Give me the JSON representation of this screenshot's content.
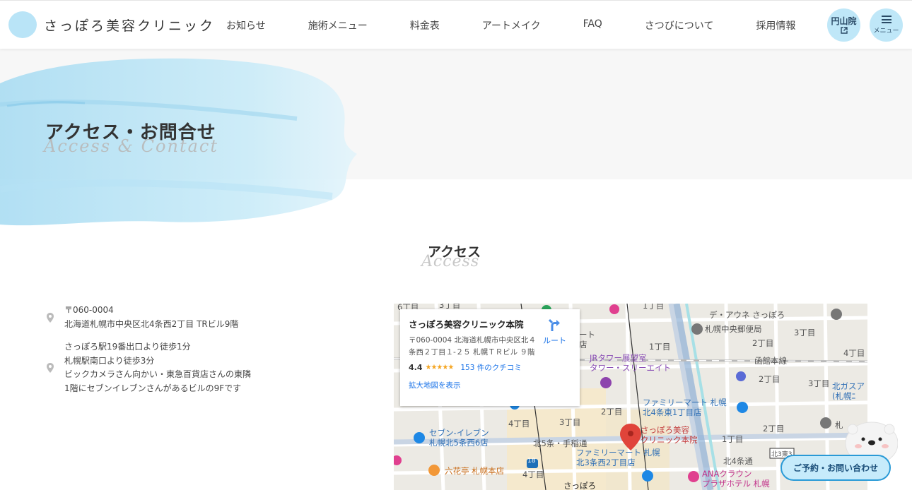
{
  "header": {
    "logo_text": "さっぽろ美容クリニック",
    "nav": [
      "お知らせ",
      "施術メニュー",
      "料金表",
      "アートメイク",
      "FAQ",
      "さつびについて",
      "採用情報"
    ],
    "maruyama_label": "円山院",
    "maruyama_icon": "external-link-icon",
    "menu_label": "メニュー"
  },
  "hero": {
    "title": "アクセス・お問合せ",
    "subtitle": "Access & Contact"
  },
  "access": {
    "title": "アクセス",
    "subtitle": "Access",
    "address": {
      "postal": "〒060-0004",
      "line": "北海道札幌市中央区北4条西2丁目 TRビル9階"
    },
    "directions": [
      "さっぽろ駅19番出口より徒歩1分",
      "札幌駅南口より徒歩3分",
      "ビックカメラさん向かい・東急百貨店さんの東隣",
      "1階にセブンイレブンさんがあるビルの9Fです"
    ]
  },
  "map": {
    "card": {
      "name": "さっぽろ美容クリニック本院",
      "address": "〒060-0004 北海道札幌市中央区北４条西２丁目１-２５ 札幌ＴＲビル ９階",
      "rating": "4.4",
      "stars": "★★★★★",
      "reviews": "153 件のクチコミ",
      "route": "ルート",
      "larger_map": "拡大地図を表示"
    },
    "labels": {
      "clinic": "さっぽろ美容\nクリニック本院",
      "de_aune": "デ・アウネ さっぽろ",
      "post_office": "札幌中央郵便局",
      "jr_tower": "JRタワー展望室\nタワー・スリーエイト",
      "family_mart_1": "ファミリーマート 札幌\n北4条東1丁目店",
      "seven": "セブン-イレブン\n札幌北5条西6店",
      "rokkatei": "六花亭 札幌本店",
      "kita5": "北5条・手稲通",
      "family_mart_2": "ファミリーマート 札幌\n北3条西2丁目店",
      "ana": "ANAクラウン\nプラザホテル 札幌",
      "sapporo": "さっぽろ",
      "hakodate": "函館本線",
      "kitagas": "北ガスア\n(札幌ﾆ",
      "kita3": "北3東3",
      "kita4": "北4条通",
      "cho1a": "1丁目",
      "cho1b": "1丁目",
      "cho2a": "2丁目",
      "cho2b": "2丁目",
      "cho2c": "2丁目",
      "cho3a": "3丁目",
      "cho3b": "3丁目",
      "cho3c": "3丁目",
      "cho4a": "4丁目",
      "cho4b": "4丁目",
      "cho4c": "4丁目",
      "cho6": "6丁目",
      "route18": "18",
      "partial_mart": "ート",
      "partial_ten": "店",
      "partial_satsu": "札",
      "partial_top": "3丁目"
    }
  },
  "floating": {
    "contact_button": "ご予約・お問い合わせ",
    "mascot_icon": "seal-mascot-icon"
  },
  "colors": {
    "accent": "#bfe7f8",
    "button_border": "#2a9ad6",
    "map_pin": "#e0443a"
  }
}
